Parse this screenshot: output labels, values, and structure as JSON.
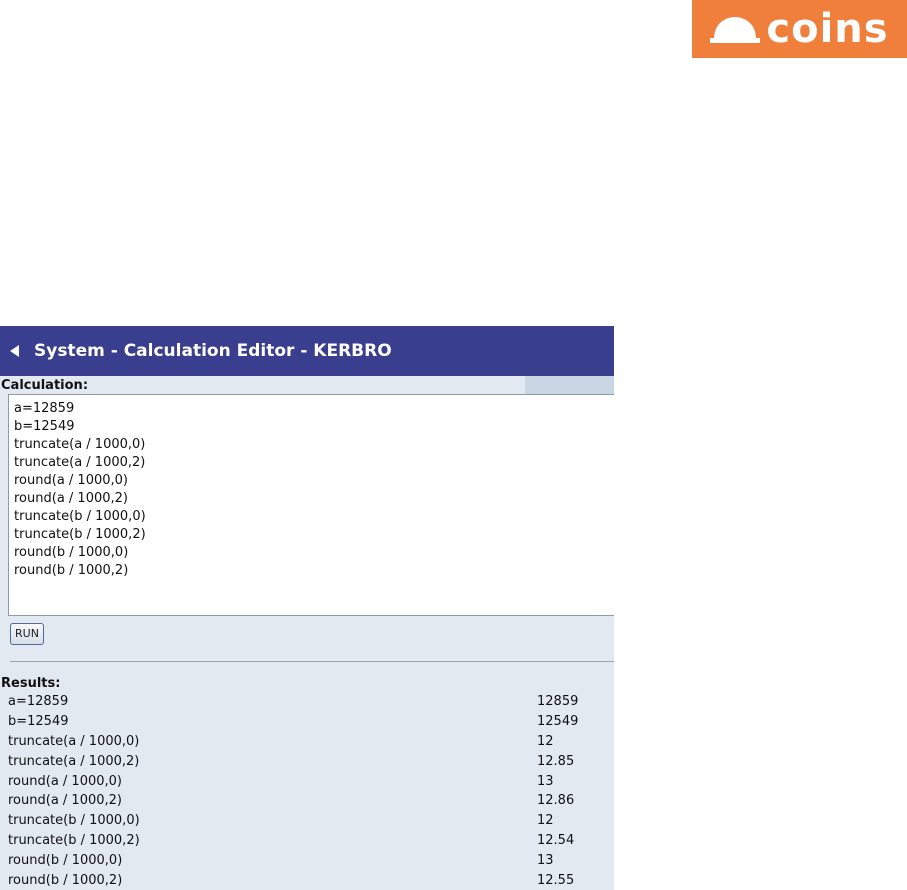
{
  "logo": {
    "text": "coins",
    "color": "#f07f3c"
  },
  "window": {
    "title": "System - Calculation Editor - KERBRO",
    "title_bar_color": "#3a3e8f"
  },
  "calculation": {
    "label": "Calculation:",
    "text": "a=12859\nb=12549\ntruncate(a / 1000,0)\ntruncate(a / 1000,2)\nround(a / 1000,0)\nround(a / 1000,2)\ntruncate(b / 1000,0)\ntruncate(b / 1000,2)\nround(b / 1000,0)\nround(b / 1000,2)"
  },
  "run_button": {
    "label": "RUN"
  },
  "results": {
    "label": "Results:",
    "rows": [
      {
        "expr": "a=12859",
        "value": "12859"
      },
      {
        "expr": "b=12549",
        "value": "12549"
      },
      {
        "expr": "truncate(a / 1000,0)",
        "value": "12"
      },
      {
        "expr": "truncate(a / 1000,2)",
        "value": "12.85"
      },
      {
        "expr": "round(a / 1000,0)",
        "value": "13"
      },
      {
        "expr": "round(a / 1000,2)",
        "value": "12.86"
      },
      {
        "expr": "truncate(b / 1000,0)",
        "value": "12"
      },
      {
        "expr": "truncate(b / 1000,2)",
        "value": "12.54"
      },
      {
        "expr": "round(b / 1000,0)",
        "value": "13"
      },
      {
        "expr": "round(b / 1000,2)",
        "value": "12.55"
      }
    ]
  }
}
